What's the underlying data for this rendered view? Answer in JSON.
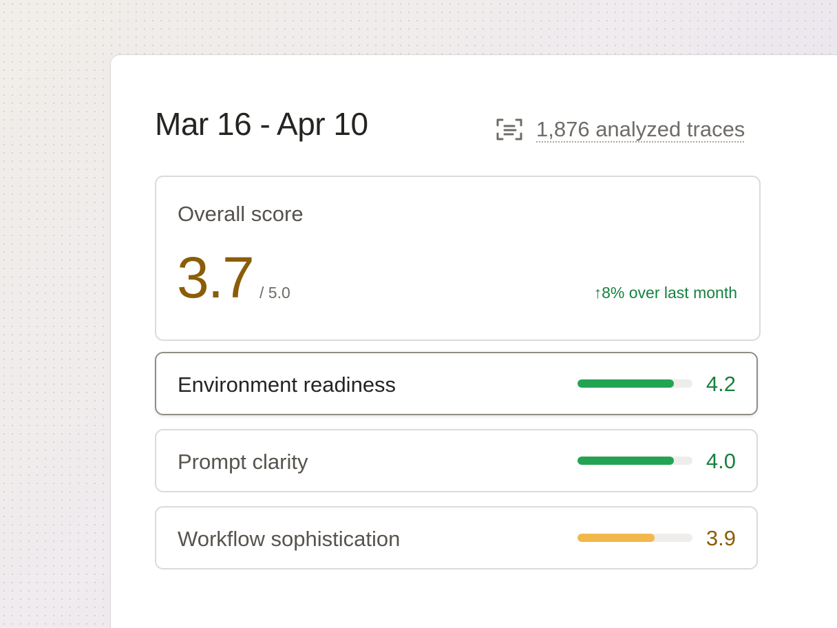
{
  "header": {
    "date_range": "Mar 16 - Apr 10",
    "traces_icon": "scan-lines-icon",
    "traces_label": "1,876 analyzed traces"
  },
  "overall": {
    "label": "Overall score",
    "value": "3.7",
    "max": "/ 5.0",
    "trend": "↑8% over last month",
    "value_color": "#8a5d06",
    "trend_color": "#16813f"
  },
  "metrics": [
    {
      "label": "Environment readiness",
      "value": "4.2",
      "score": 4.2,
      "bar_fraction": 0.84,
      "bar_color": "#24a453",
      "value_color": "#16813f",
      "active": true
    },
    {
      "label": "Prompt clarity",
      "value": "4.0",
      "score": 4.0,
      "bar_fraction": 0.84,
      "bar_color": "#24a453",
      "value_color": "#16813f",
      "active": false
    },
    {
      "label": "Workflow sophistication",
      "value": "3.9",
      "score": 3.9,
      "bar_fraction": 0.67,
      "bar_color": "#f2b84b",
      "value_color": "#8a5d06",
      "active": false
    }
  ]
}
